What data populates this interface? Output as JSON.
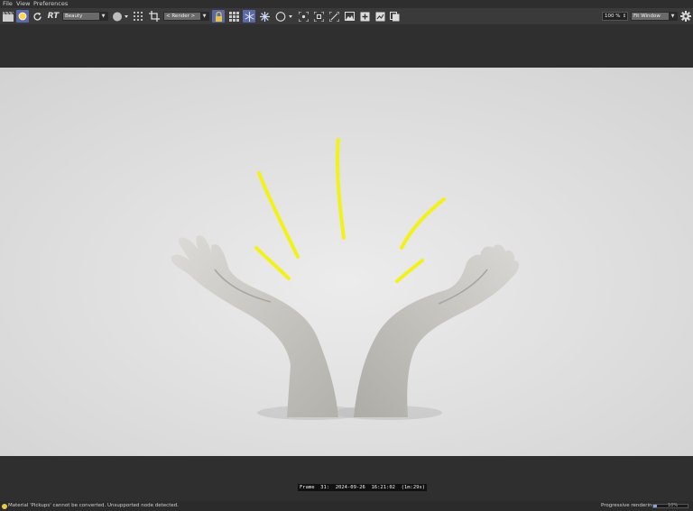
{
  "menu": {
    "file": "File",
    "view": "View",
    "preferences": "Preferences"
  },
  "toolbar": {
    "rt_label": "RT",
    "pass_select": "Beauty",
    "render_select": "< Render >",
    "zoom_value": "100 %",
    "fit_select": "Fit Window"
  },
  "viewport": {
    "frame_info": "Frame  31:  2024-09-26  16:21:02  (1m:29s)"
  },
  "status": {
    "message": "Material 'Pickups' cannot be converted. Unsupported node detected.",
    "progressive_label": "Progressive rendering",
    "progress_percent": 10,
    "progress_text": "10%"
  },
  "colors": {
    "accent": "#5a6aa8",
    "highlight_strokes": "#f2f21a",
    "warning": "#e9c84a"
  }
}
